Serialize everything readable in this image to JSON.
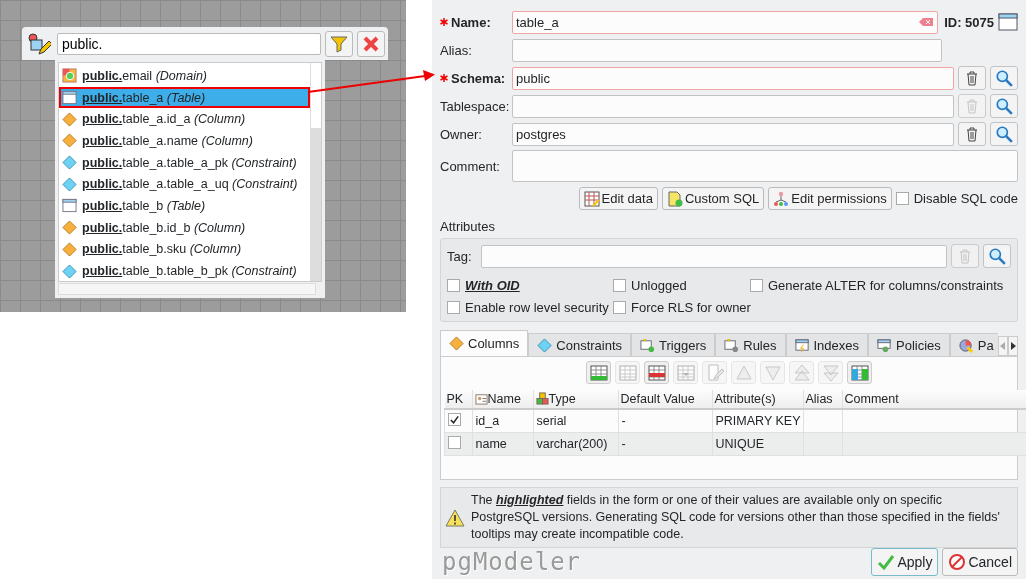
{
  "search": {
    "value": "public."
  },
  "results": [
    {
      "match": "public.",
      "name": "email",
      "type": "(Domain)",
      "kind": "domain",
      "selected": false
    },
    {
      "match": "public.",
      "name": "table_a",
      "type": "(Table)",
      "kind": "table",
      "selected": true
    },
    {
      "match": "public.",
      "name": "table_a.id_a",
      "type": "(Column)",
      "kind": "column",
      "selected": false
    },
    {
      "match": "public.",
      "name": "table_a.name",
      "type": "(Column)",
      "kind": "column",
      "selected": false
    },
    {
      "match": "public.",
      "name": "table_a.table_a_pk",
      "type": "(Constraint)",
      "kind": "constraint",
      "selected": false
    },
    {
      "match": "public.",
      "name": "table_a.table_a_uq",
      "type": "(Constraint)",
      "kind": "constraint",
      "selected": false
    },
    {
      "match": "public.",
      "name": "table_b",
      "type": "(Table)",
      "kind": "table",
      "selected": false
    },
    {
      "match": "public.",
      "name": "table_b.id_b",
      "type": "(Column)",
      "kind": "column",
      "selected": false
    },
    {
      "match": "public.",
      "name": "table_b.sku",
      "type": "(Column)",
      "kind": "column",
      "selected": false
    },
    {
      "match": "public.",
      "name": "table_b.table_b_pk",
      "type": "(Constraint)",
      "kind": "constraint",
      "selected": false
    }
  ],
  "form": {
    "id_label": "ID: 5075",
    "fields": [
      {
        "kind": "name",
        "label": "Name:",
        "required": true,
        "value": "table_a"
      },
      {
        "kind": "plain",
        "label": "Alias:",
        "required": false
      },
      {
        "kind": "object",
        "label": "Schema:",
        "required": true,
        "value": "public",
        "remove_disabled": false
      },
      {
        "kind": "object",
        "label": "Tablespace:",
        "required": false,
        "remove_disabled": true
      },
      {
        "kind": "object",
        "label": "Owner:",
        "required": false,
        "value": "postgres",
        "remove_disabled": false
      },
      {
        "kind": "text",
        "label": "Comment:",
        "required": false
      }
    ],
    "buttons": [
      {
        "label": "Edit data",
        "kind": "data"
      },
      {
        "label": "Custom SQL",
        "kind": "sql"
      },
      {
        "label": "Edit permissions",
        "kind": "permissions"
      }
    ],
    "disable_sql": {
      "label": "Disable SQL code",
      "checked": false
    }
  },
  "attributes": {
    "title": "Attributes",
    "tag_label": "Tag:",
    "tag_remove_disabled": true,
    "options": [
      {
        "label": "With OID",
        "checked": false,
        "highlighted": true
      },
      {
        "label": "Unlogged",
        "checked": false,
        "highlighted": false
      },
      {
        "label": "Generate ALTER for columns/constraints",
        "checked": false,
        "highlighted": false
      },
      {
        "label": "Enable row level security",
        "checked": false,
        "highlighted": false
      },
      {
        "label": "Force RLS for owner",
        "checked": false,
        "highlighted": false
      }
    ]
  },
  "tabs": [
    {
      "label": "Columns",
      "kind": "column",
      "selected": true
    },
    {
      "label": "Constraints",
      "kind": "constraint",
      "selected": false
    },
    {
      "label": "Triggers",
      "kind": "trigger",
      "selected": false
    },
    {
      "label": "Rules",
      "kind": "rule",
      "selected": false
    },
    {
      "label": "Indexes",
      "kind": "index",
      "selected": false
    },
    {
      "label": "Policies",
      "kind": "policy",
      "selected": false
    },
    {
      "label": "Pa",
      "kind": "partition",
      "selected": false
    }
  ],
  "toolbar": [
    {
      "kind": "add",
      "disabled": false
    },
    {
      "kind": "update",
      "disabled": true
    },
    {
      "kind": "remove",
      "disabled": false
    },
    {
      "kind": "remove_all",
      "disabled": true
    },
    {
      "kind": "edit",
      "disabled": true
    },
    {
      "kind": "up",
      "disabled": true
    },
    {
      "kind": "down",
      "disabled": true
    },
    {
      "kind": "top",
      "disabled": true
    },
    {
      "kind": "bottom",
      "disabled": true
    },
    {
      "kind": "duplicate",
      "disabled": false
    }
  ],
  "table": {
    "columns": [
      "PK",
      "Name",
      "Type",
      "Default Value",
      "Attribute(s)",
      "Alias",
      "Comment"
    ],
    "rows": [
      {
        "pk": true,
        "name": "id_a",
        "type": "serial",
        "default_value": "-",
        "attributes": "PRIMARY KEY"
      },
      {
        "pk": false,
        "name": "name",
        "type": "varchar(200)",
        "default_value": "-",
        "attributes": "UNIQUE"
      }
    ]
  },
  "note": "The **highlighted** fields in the form or one of their values are available only on specific PostgreSQL versions. Generating SQL code for versions other than those specified in the fields' tooltips may create incompatible code.",
  "logo": "pgModeler",
  "actions": [
    {
      "label": "Apply",
      "kind": "apply"
    },
    {
      "label": "Cancel",
      "kind": "cancel"
    }
  ]
}
